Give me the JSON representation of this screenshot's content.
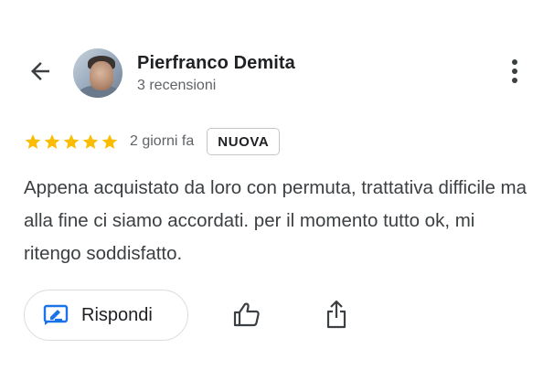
{
  "header": {
    "back_icon": "arrow-back-icon",
    "more_icon": "more-vert-icon"
  },
  "user": {
    "name": "Pierfranco Demita",
    "meta": "3 recensioni"
  },
  "review": {
    "rating": 5,
    "rating_max": 5,
    "star_color": "#fbbc04",
    "date": "2 giorni fa",
    "badge": "NUOVA",
    "text": "Appena acquistato da loro con permuta, trattativa difficile ma alla fine ci siamo accordati. per il momento tutto ok, mi ritengo soddisfatto."
  },
  "actions": {
    "reply_label": "Rispondi",
    "reply_icon": "reply-icon",
    "like_icon": "thumb-up-icon",
    "share_icon": "share-icon",
    "accent_color": "#1a73e8"
  }
}
